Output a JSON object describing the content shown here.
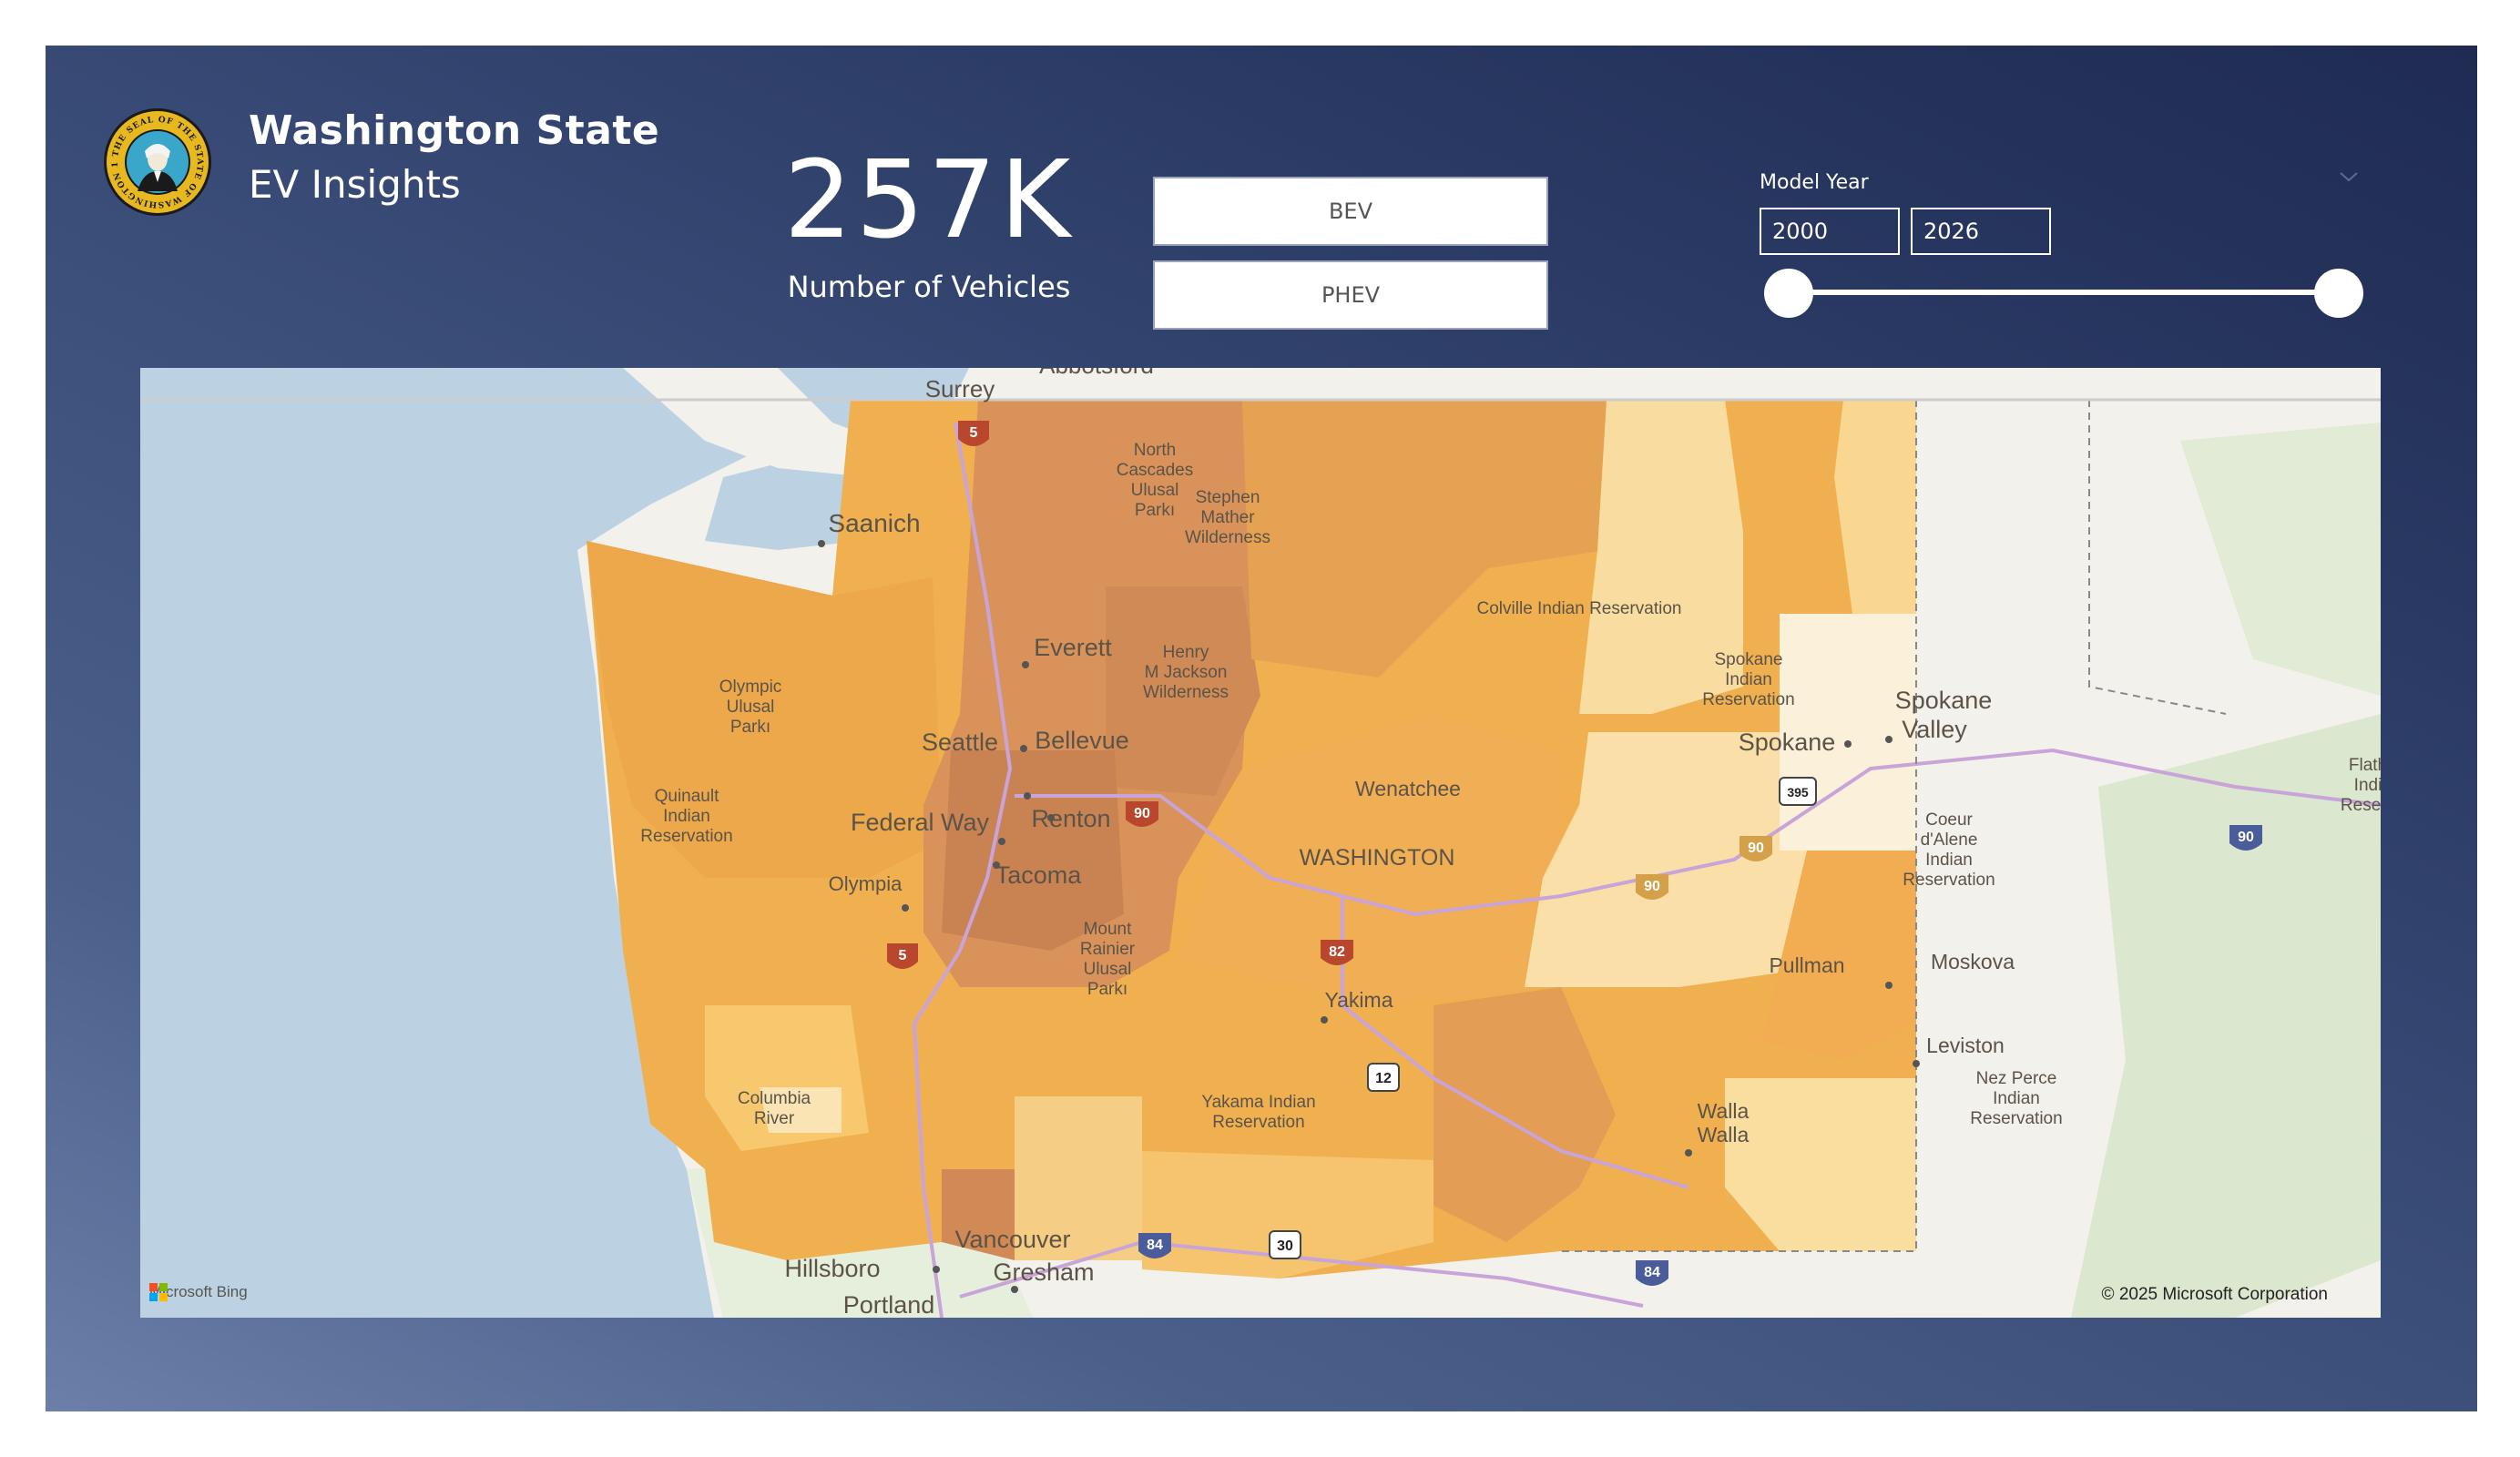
{
  "header": {
    "title": "Washington State",
    "subtitle": "EV Insights",
    "seal_text": "THE SEAL OF THE STATE OF WASHINGTON 1889"
  },
  "kpi": {
    "value": "257K",
    "label": "Number of Vehicles"
  },
  "vehicle_type_buttons": [
    {
      "label": "BEV"
    },
    {
      "label": "PHEV"
    }
  ],
  "model_year_filter": {
    "title": "Model Year",
    "start": "2000",
    "end": "2026",
    "range_min": 2000,
    "range_max": 2026
  },
  "map": {
    "provider": "Microsoft Bing",
    "copyright": "© 2025 Microsoft Corporation",
    "fill_color_light": "#fde3a7",
    "fill_color_dark": "#c98352",
    "labels": {
      "surrey": "Surrey",
      "abbotsford": "Abbotsford",
      "saanich": "Saanich",
      "north_cascades": [
        "North",
        "Cascades",
        "Ulusal",
        "Parkı"
      ],
      "stephen_mather": [
        "Stephen",
        "Mather",
        "Wilderness"
      ],
      "colville": "Colville Indian Reservation",
      "olympic": [
        "Olympic",
        "Ulusal",
        "Parkı"
      ],
      "everett": "Everett",
      "henry_jackson": [
        "Henry",
        "M Jackson",
        "Wilderness"
      ],
      "spokane_res": [
        "Spokane",
        "Indian",
        "Reservation"
      ],
      "spokane_valley": [
        "Spokane",
        "Valley"
      ],
      "spokane": "Spokane",
      "seattle": "Seattle",
      "bellevue": "Bellevue",
      "quinault": [
        "Quinault",
        "Indian",
        "Reservation"
      ],
      "wenatchee": "Wenatchee",
      "flathead": [
        "Flath",
        "Indi",
        "Reserv"
      ],
      "federal_way": "Federal Way",
      "renton": "Renton",
      "coeur": [
        "Coeur",
        "d'Alene",
        "Indian",
        "Reservation"
      ],
      "washington": "WASHINGTON",
      "olympia": "Olympia",
      "tacoma": "Tacoma",
      "mount_rainier": [
        "Mount",
        "Rainier",
        "Ulusal",
        "Parkı"
      ],
      "pullman": "Pullman",
      "moskova": "Moskova",
      "yakima": "Yakima",
      "leviston": "Leviston",
      "nez_perce": [
        "Nez Perce",
        "Indian",
        "Reservation"
      ],
      "columbia": [
        "Columbia",
        "River"
      ],
      "yakama": [
        "Yakama Indian",
        "Reservation"
      ],
      "walla": [
        "Walla",
        "Walla"
      ],
      "vancouver": "Vancouver",
      "hillsboro": "Hillsboro",
      "gresham": "Gresham",
      "portland": "Portland"
    },
    "shields": {
      "i5_north": "5",
      "i5_south": "5",
      "i90_west": "90",
      "i90_mid": "90",
      "i90_east": "90",
      "i90_far": "90",
      "i82": "82",
      "us12": "12",
      "us395": "395",
      "i84_west": "84",
      "i84_east": "84",
      "us30": "30"
    }
  }
}
